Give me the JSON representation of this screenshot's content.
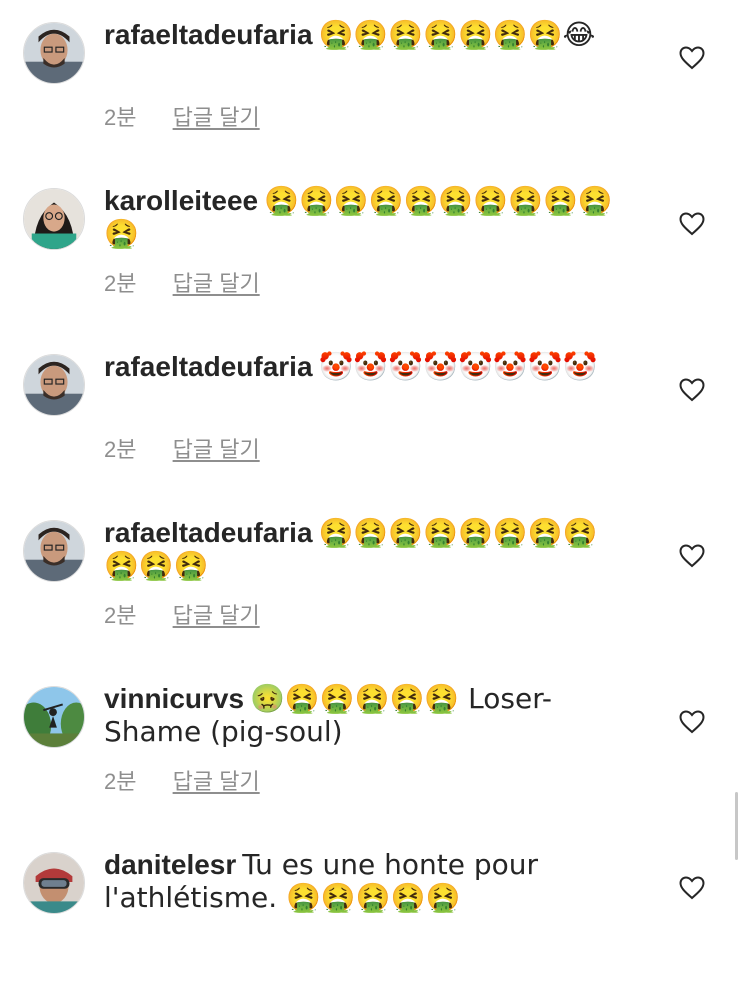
{
  "comments": [
    {
      "username": "rafaeltadeufaria",
      "text": "🤮🤮🤮🤮🤮🤮🤮😂",
      "time": "2분",
      "reply_label": "답글 달기",
      "avatar_icon": "profile-photo-man",
      "like_icon": "heart-outline-icon"
    },
    {
      "username": "karolleiteee",
      "text": "🤮🤮🤮🤮🤮🤮🤮🤮🤮🤮🤮",
      "time": "2분",
      "reply_label": "답글 달기",
      "avatar_icon": "profile-photo-woman",
      "like_icon": "heart-outline-icon"
    },
    {
      "username": "rafaeltadeufaria",
      "text": "🤡🤡🤡🤡🤡🤡🤡🤡",
      "time": "2분",
      "reply_label": "답글 달기",
      "avatar_icon": "profile-photo-man",
      "like_icon": "heart-outline-icon"
    },
    {
      "username": "rafaeltadeufaria",
      "text": "🤮🤮🤮🤮🤮🤮🤮🤮🤮🤮🤮",
      "time": "2분",
      "reply_label": "답글 달기",
      "avatar_icon": "profile-photo-man",
      "like_icon": "heart-outline-icon"
    },
    {
      "username": "vinnicurvs",
      "text": "🤢🤮🤮🤮🤮🤮 Loser-Shame (pig-soul)",
      "time": "2분",
      "reply_label": "답글 달기",
      "avatar_icon": "profile-photo-outdoor",
      "like_icon": "heart-outline-icon"
    },
    {
      "username": "danitelesr",
      "text": "Tu es une honte pour l'athlétisme. 🤮🤮🤮🤮🤮",
      "time": "",
      "reply_label": "",
      "avatar_icon": "profile-photo-goggles",
      "like_icon": "heart-outline-icon"
    }
  ],
  "colors": {
    "text": "#262626",
    "meta": "#8e8e8e",
    "heart_stroke": "#262626"
  }
}
